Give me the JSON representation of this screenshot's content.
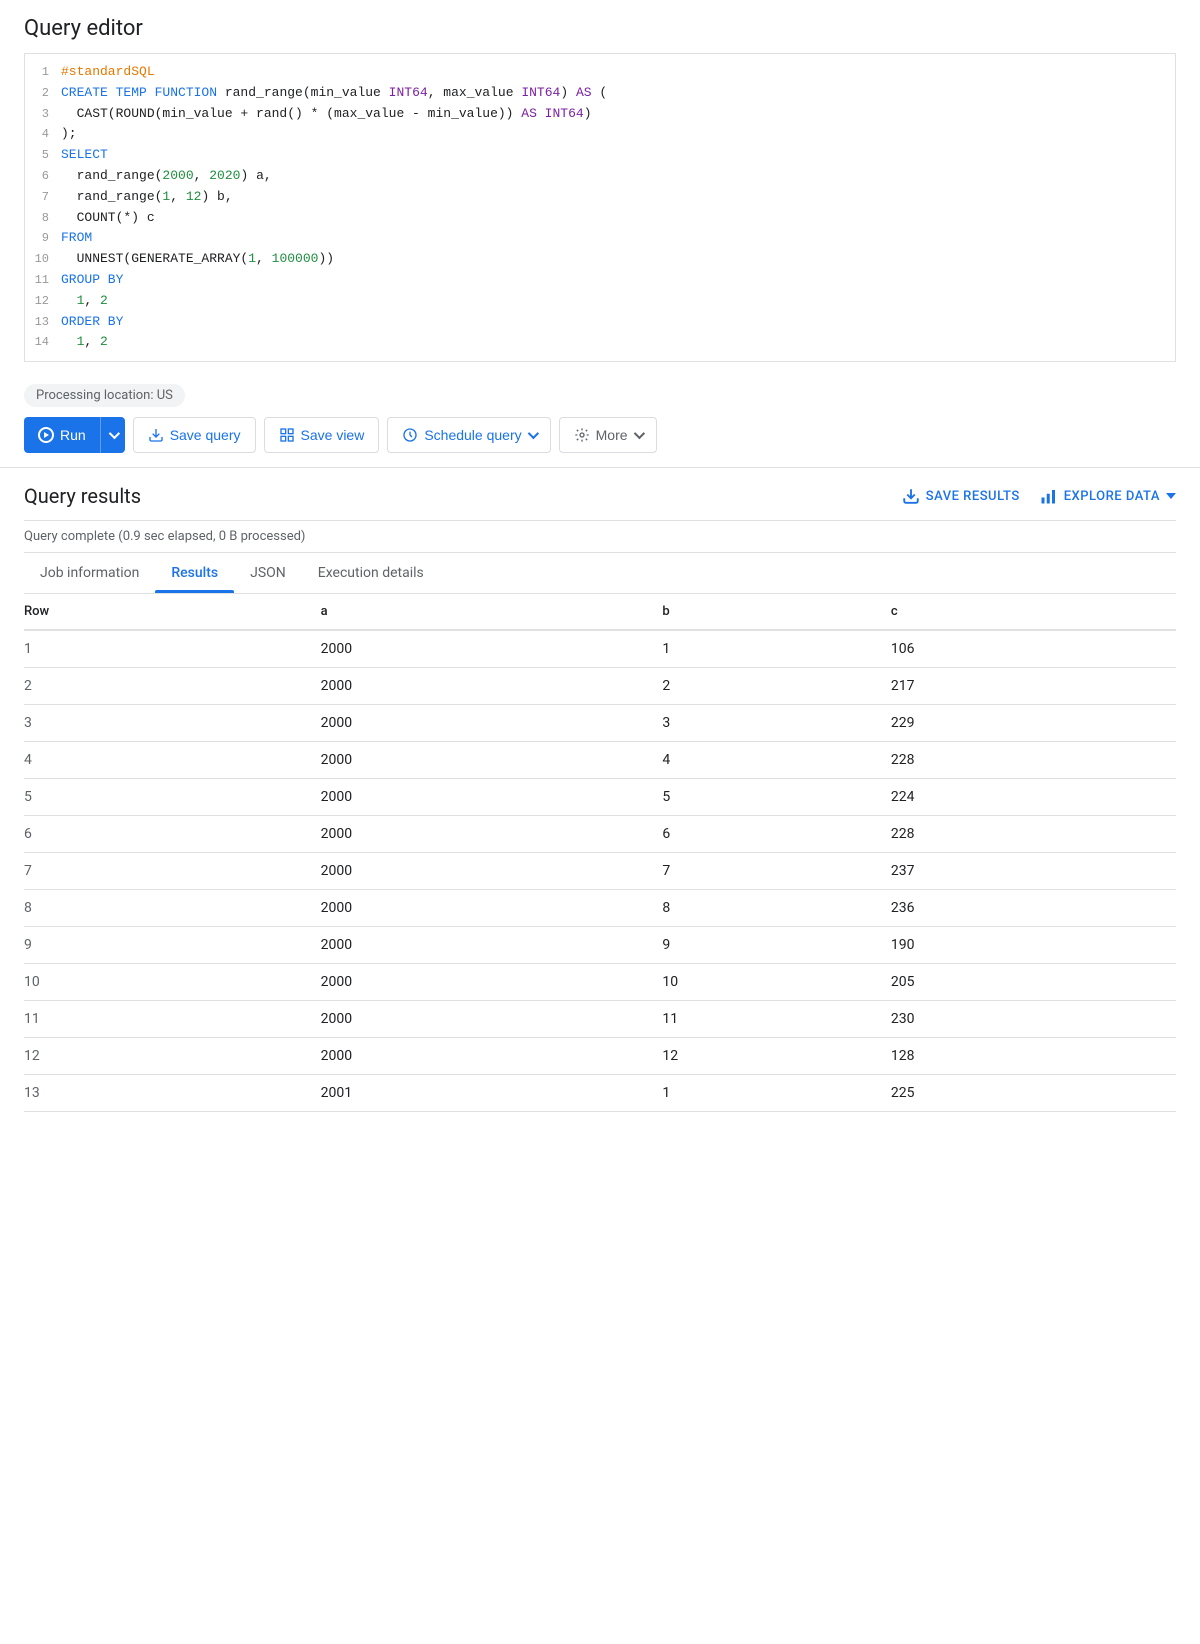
{
  "page": {
    "title": "Query editor"
  },
  "editor": {
    "lines": [
      {
        "num": 1,
        "tokens": [
          {
            "text": "#standardSQL",
            "class": "kw-hash"
          }
        ]
      },
      {
        "num": 2,
        "raw": "CREATE TEMP FUNCTION rand_range(min_value INT64, max_value INT64) AS ("
      },
      {
        "num": 3,
        "raw": "  CAST(ROUND(min_value + rand() * (max_value - min_value)) AS INT64)"
      },
      {
        "num": 4,
        "raw": ");"
      },
      {
        "num": 5,
        "tokens": [
          {
            "text": "SELECT",
            "class": "kw-blue"
          }
        ]
      },
      {
        "num": 6,
        "raw": "  rand_range(2000, 2020) a,"
      },
      {
        "num": 7,
        "raw": "  rand_range(1, 12) b,"
      },
      {
        "num": 8,
        "raw": "  COUNT(*) c"
      },
      {
        "num": 9,
        "tokens": [
          {
            "text": "FROM",
            "class": "kw-blue"
          }
        ]
      },
      {
        "num": 10,
        "raw": "  UNNEST(GENERATE_ARRAY(1, 100000))"
      },
      {
        "num": 11,
        "tokens": [
          {
            "text": "GROUP BY",
            "class": "kw-blue"
          }
        ]
      },
      {
        "num": 12,
        "raw": "  1, 2"
      },
      {
        "num": 13,
        "tokens": [
          {
            "text": "ORDER BY",
            "class": "kw-blue"
          }
        ]
      },
      {
        "num": 14,
        "raw": "  1, 2"
      }
    ]
  },
  "toolbar": {
    "processing_location": "Processing location: US",
    "run_label": "Run",
    "save_query_label": "Save query",
    "save_view_label": "Save view",
    "schedule_query_label": "Schedule query",
    "more_label": "More"
  },
  "results": {
    "title": "Query results",
    "save_results_label": "SAVE RESULTS",
    "explore_data_label": "EXPLORE DATA",
    "status": "Query complete (0.9 sec elapsed, 0 B processed)",
    "tabs": [
      {
        "id": "job-info",
        "label": "Job information"
      },
      {
        "id": "results",
        "label": "Results"
      },
      {
        "id": "json",
        "label": "JSON"
      },
      {
        "id": "execution",
        "label": "Execution details"
      }
    ],
    "active_tab": "results",
    "columns": [
      "Row",
      "a",
      "b",
      "c"
    ],
    "rows": [
      [
        1,
        2000,
        1,
        106
      ],
      [
        2,
        2000,
        2,
        217
      ],
      [
        3,
        2000,
        3,
        229
      ],
      [
        4,
        2000,
        4,
        228
      ],
      [
        5,
        2000,
        5,
        224
      ],
      [
        6,
        2000,
        6,
        228
      ],
      [
        7,
        2000,
        7,
        237
      ],
      [
        8,
        2000,
        8,
        236
      ],
      [
        9,
        2000,
        9,
        190
      ],
      [
        10,
        2000,
        10,
        205
      ],
      [
        11,
        2000,
        11,
        230
      ],
      [
        12,
        2000,
        12,
        128
      ],
      [
        13,
        2001,
        1,
        225
      ]
    ]
  },
  "colors": {
    "blue": "#1a73e8",
    "purple": "#7b1fa2",
    "hash": "#e67700",
    "green": "#1e8e3e"
  }
}
